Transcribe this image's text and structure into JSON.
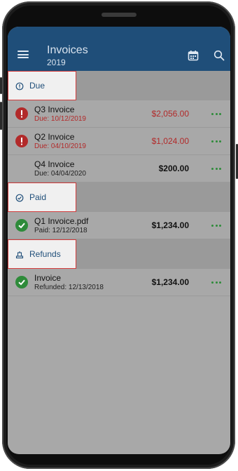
{
  "appbar": {
    "title": "Invoices",
    "subtitle": "2019",
    "icons": [
      "menu-icon",
      "calendar-icon",
      "search-icon"
    ]
  },
  "sections": {
    "due": {
      "label": "Due",
      "icon": "info-icon"
    },
    "paid": {
      "label": "Paid",
      "icon": "check-circle-icon"
    },
    "refunds": {
      "label": "Refunds",
      "icon": "refund-icon"
    }
  },
  "due_items": [
    {
      "title": "Q3 Invoice",
      "sub": "Due: 10/12/2019",
      "amount": "$2,056.00",
      "status": "error-icon"
    },
    {
      "title": "Q2 Invoice",
      "sub": "Due: 04/10/2019",
      "amount": "$1,024.00",
      "status": "error-icon"
    },
    {
      "title": "Q4 Invoice",
      "sub": "Due: 04/04/2020",
      "amount": "$200.00",
      "status": "none"
    }
  ],
  "paid_items": [
    {
      "title": "Q1 Invoice.pdf",
      "sub": "Paid: 12/12/2018",
      "amount": "$1,234.00",
      "status": "check-icon"
    }
  ],
  "refund_items": [
    {
      "title": "Invoice",
      "sub": "Refunded: 12/13/2018",
      "amount": "$1,234.00",
      "status": "check-icon"
    }
  ],
  "colors": {
    "appbar": "#1f4e79",
    "error": "#b22a2a",
    "success": "#2e8b3a"
  }
}
